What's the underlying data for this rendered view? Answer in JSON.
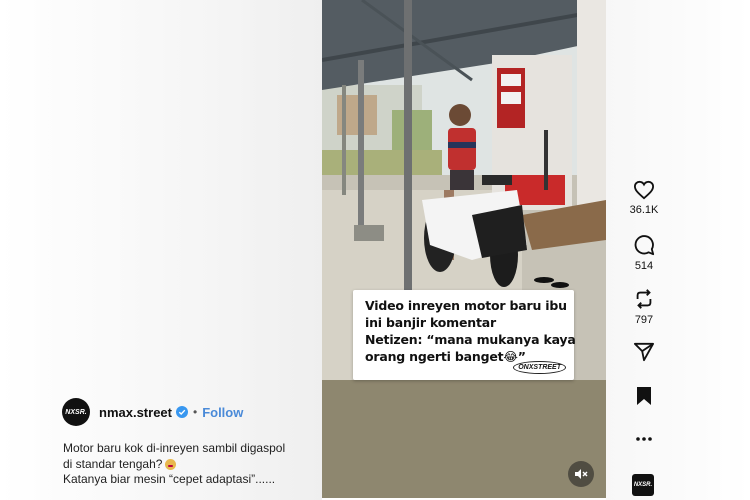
{
  "video": {
    "overlay_lines": [
      "Video inreyen motor baru ibu",
      "ini banjir komentar",
      "Netizen: “mana mukanya kaya",
      "orang ngerti banget😂”"
    ],
    "overlay_logo": "ONXSTREET",
    "mute_icon": "speaker-muted-icon"
  },
  "author": {
    "avatar_text": "NXSR.",
    "username": "nmax.street",
    "separator": "•",
    "follow_label": "Follow"
  },
  "caption": {
    "line1": "Motor baru kok di-inreyen sambil digaspol",
    "line2": "di standar tengah?",
    "line3": "Katanya biar mesin “cepet adaptasi”......"
  },
  "actions": {
    "like_count": "36.1K",
    "comment_count": "514",
    "repost_count": "797",
    "icons": [
      "heart-icon",
      "comment-icon",
      "repost-icon",
      "share-icon",
      "bookmark-icon",
      "more-icon"
    ]
  },
  "brand_tile_text": "NXSR.",
  "colors": {
    "follow": "#4a8ad8",
    "verified": "#3897f0"
  }
}
